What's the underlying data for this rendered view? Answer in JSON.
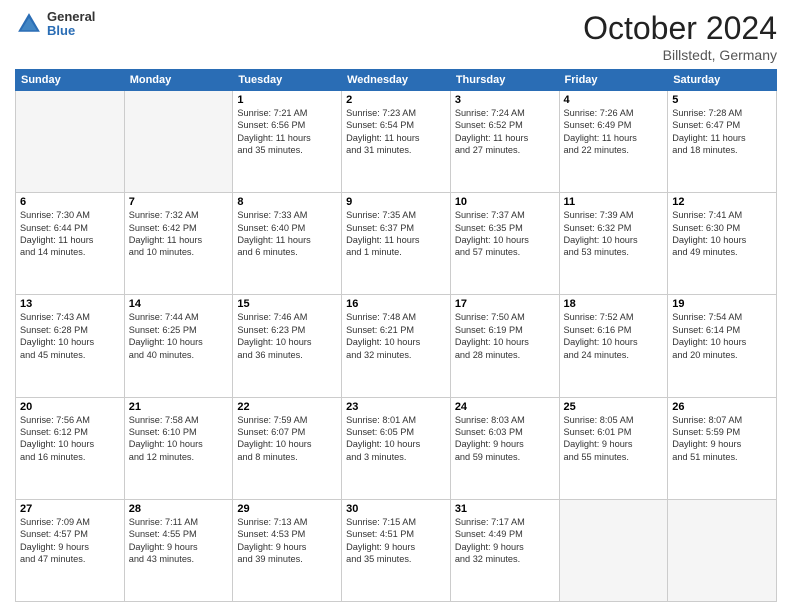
{
  "header": {
    "logo_general": "General",
    "logo_blue": "Blue",
    "month": "October 2024",
    "location": "Billstedt, Germany"
  },
  "weekdays": [
    "Sunday",
    "Monday",
    "Tuesday",
    "Wednesday",
    "Thursday",
    "Friday",
    "Saturday"
  ],
  "weeks": [
    [
      {
        "day": "",
        "detail": ""
      },
      {
        "day": "",
        "detail": ""
      },
      {
        "day": "1",
        "detail": "Sunrise: 7:21 AM\nSunset: 6:56 PM\nDaylight: 11 hours\nand 35 minutes."
      },
      {
        "day": "2",
        "detail": "Sunrise: 7:23 AM\nSunset: 6:54 PM\nDaylight: 11 hours\nand 31 minutes."
      },
      {
        "day": "3",
        "detail": "Sunrise: 7:24 AM\nSunset: 6:52 PM\nDaylight: 11 hours\nand 27 minutes."
      },
      {
        "day": "4",
        "detail": "Sunrise: 7:26 AM\nSunset: 6:49 PM\nDaylight: 11 hours\nand 22 minutes."
      },
      {
        "day": "5",
        "detail": "Sunrise: 7:28 AM\nSunset: 6:47 PM\nDaylight: 11 hours\nand 18 minutes."
      }
    ],
    [
      {
        "day": "6",
        "detail": "Sunrise: 7:30 AM\nSunset: 6:44 PM\nDaylight: 11 hours\nand 14 minutes."
      },
      {
        "day": "7",
        "detail": "Sunrise: 7:32 AM\nSunset: 6:42 PM\nDaylight: 11 hours\nand 10 minutes."
      },
      {
        "day": "8",
        "detail": "Sunrise: 7:33 AM\nSunset: 6:40 PM\nDaylight: 11 hours\nand 6 minutes."
      },
      {
        "day": "9",
        "detail": "Sunrise: 7:35 AM\nSunset: 6:37 PM\nDaylight: 11 hours\nand 1 minute."
      },
      {
        "day": "10",
        "detail": "Sunrise: 7:37 AM\nSunset: 6:35 PM\nDaylight: 10 hours\nand 57 minutes."
      },
      {
        "day": "11",
        "detail": "Sunrise: 7:39 AM\nSunset: 6:32 PM\nDaylight: 10 hours\nand 53 minutes."
      },
      {
        "day": "12",
        "detail": "Sunrise: 7:41 AM\nSunset: 6:30 PM\nDaylight: 10 hours\nand 49 minutes."
      }
    ],
    [
      {
        "day": "13",
        "detail": "Sunrise: 7:43 AM\nSunset: 6:28 PM\nDaylight: 10 hours\nand 45 minutes."
      },
      {
        "day": "14",
        "detail": "Sunrise: 7:44 AM\nSunset: 6:25 PM\nDaylight: 10 hours\nand 40 minutes."
      },
      {
        "day": "15",
        "detail": "Sunrise: 7:46 AM\nSunset: 6:23 PM\nDaylight: 10 hours\nand 36 minutes."
      },
      {
        "day": "16",
        "detail": "Sunrise: 7:48 AM\nSunset: 6:21 PM\nDaylight: 10 hours\nand 32 minutes."
      },
      {
        "day": "17",
        "detail": "Sunrise: 7:50 AM\nSunset: 6:19 PM\nDaylight: 10 hours\nand 28 minutes."
      },
      {
        "day": "18",
        "detail": "Sunrise: 7:52 AM\nSunset: 6:16 PM\nDaylight: 10 hours\nand 24 minutes."
      },
      {
        "day": "19",
        "detail": "Sunrise: 7:54 AM\nSunset: 6:14 PM\nDaylight: 10 hours\nand 20 minutes."
      }
    ],
    [
      {
        "day": "20",
        "detail": "Sunrise: 7:56 AM\nSunset: 6:12 PM\nDaylight: 10 hours\nand 16 minutes."
      },
      {
        "day": "21",
        "detail": "Sunrise: 7:58 AM\nSunset: 6:10 PM\nDaylight: 10 hours\nand 12 minutes."
      },
      {
        "day": "22",
        "detail": "Sunrise: 7:59 AM\nSunset: 6:07 PM\nDaylight: 10 hours\nand 8 minutes."
      },
      {
        "day": "23",
        "detail": "Sunrise: 8:01 AM\nSunset: 6:05 PM\nDaylight: 10 hours\nand 3 minutes."
      },
      {
        "day": "24",
        "detail": "Sunrise: 8:03 AM\nSunset: 6:03 PM\nDaylight: 9 hours\nand 59 minutes."
      },
      {
        "day": "25",
        "detail": "Sunrise: 8:05 AM\nSunset: 6:01 PM\nDaylight: 9 hours\nand 55 minutes."
      },
      {
        "day": "26",
        "detail": "Sunrise: 8:07 AM\nSunset: 5:59 PM\nDaylight: 9 hours\nand 51 minutes."
      }
    ],
    [
      {
        "day": "27",
        "detail": "Sunrise: 7:09 AM\nSunset: 4:57 PM\nDaylight: 9 hours\nand 47 minutes."
      },
      {
        "day": "28",
        "detail": "Sunrise: 7:11 AM\nSunset: 4:55 PM\nDaylight: 9 hours\nand 43 minutes."
      },
      {
        "day": "29",
        "detail": "Sunrise: 7:13 AM\nSunset: 4:53 PM\nDaylight: 9 hours\nand 39 minutes."
      },
      {
        "day": "30",
        "detail": "Sunrise: 7:15 AM\nSunset: 4:51 PM\nDaylight: 9 hours\nand 35 minutes."
      },
      {
        "day": "31",
        "detail": "Sunrise: 7:17 AM\nSunset: 4:49 PM\nDaylight: 9 hours\nand 32 minutes."
      },
      {
        "day": "",
        "detail": ""
      },
      {
        "day": "",
        "detail": ""
      }
    ]
  ]
}
